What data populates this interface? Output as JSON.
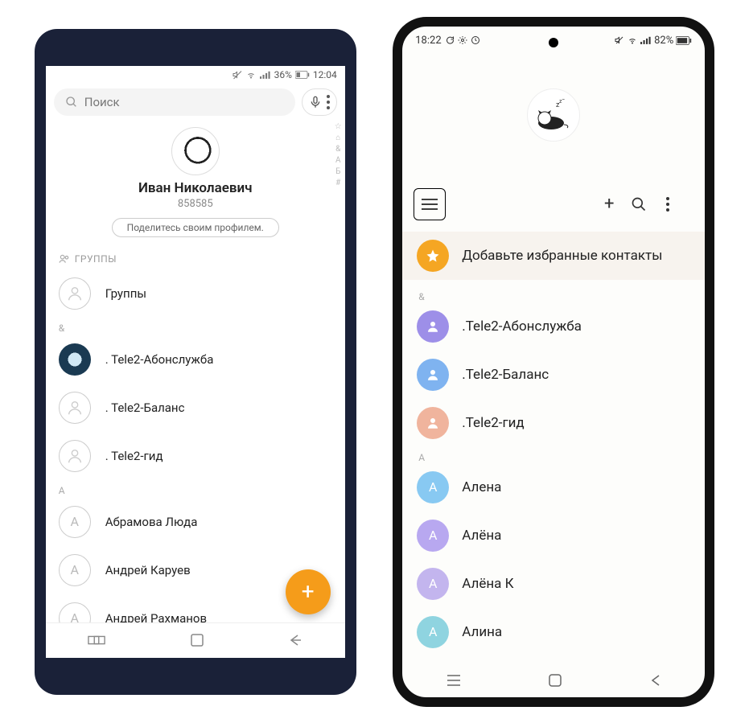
{
  "phone1": {
    "status": {
      "battery_text": "36%",
      "time": "12:04"
    },
    "search_placeholder": "Поиск",
    "profile": {
      "name": "Иван Николаевич",
      "number": "858585"
    },
    "share_button": "Поделитесь своим профилем.",
    "groups_header": "ГРУППЫ",
    "groups_row": "Группы",
    "sym_header": "&",
    "contacts_sym": [
      {
        "label": ". Tele2-Абонслужба"
      },
      {
        "label": ". Tele2-Баланс"
      },
      {
        "label": ". Tele2-гид"
      }
    ],
    "letter_a_header": "А",
    "contacts_a": [
      {
        "initial": "А",
        "label": "Абрамова Люда"
      },
      {
        "initial": "А",
        "label": "Андрей Каруев"
      },
      {
        "initial": "А",
        "label": "Андрей Рахманов"
      }
    ],
    "index": [
      "☆",
      "⌂",
      "&",
      "А",
      "Б",
      "#"
    ]
  },
  "phone2": {
    "status": {
      "time": "18:22",
      "battery_text": "82%"
    },
    "favorite_label": "Добавьте избранные контакты",
    "sym_header": "&",
    "contacts_sym": [
      {
        "initial": "",
        "label": ".Tele2-Абонслужба"
      },
      {
        "initial": "",
        "label": ".Tele2-Баланс"
      },
      {
        "initial": "",
        "label": ".Tele2-гид"
      }
    ],
    "letter_a_header": "А",
    "contacts_a": [
      {
        "initial": "А",
        "label": "Алена"
      },
      {
        "initial": "А",
        "label": "Алёна"
      },
      {
        "initial": "А",
        "label": "Алёна К"
      },
      {
        "initial": "А",
        "label": "Алина"
      }
    ]
  }
}
